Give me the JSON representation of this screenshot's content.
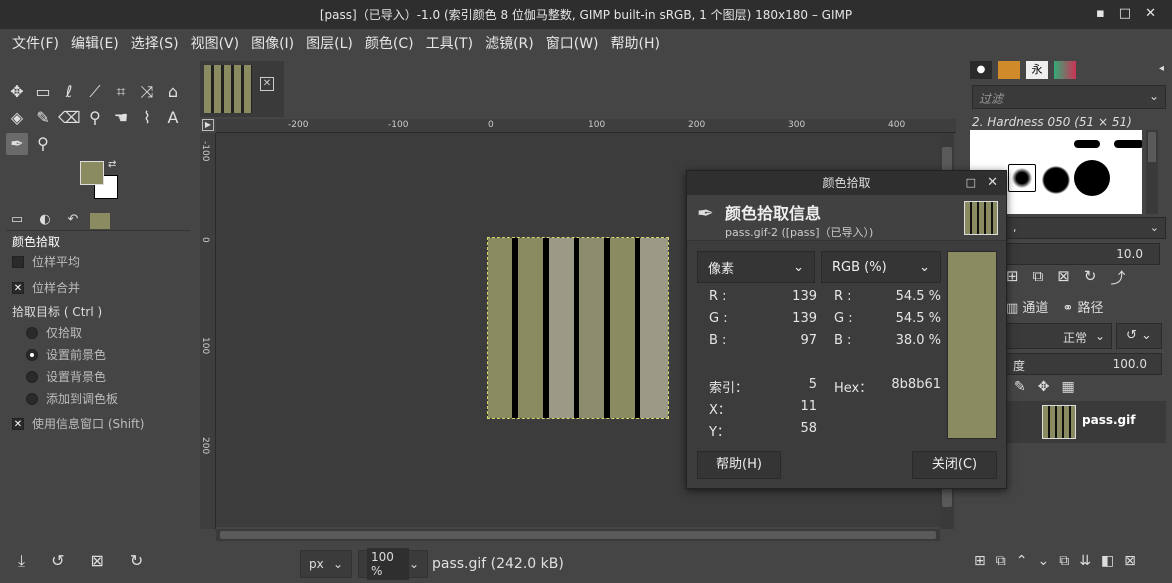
{
  "window": {
    "title": "[pass]（已导入）-1.0 (索引颜色 8 位伽马整数, GIMP built-in sRGB, 1 个图层) 180x180 – GIMP",
    "min": "▪",
    "max": "□",
    "close": "✕"
  },
  "menu": [
    "文件(F)",
    "编辑(E)",
    "选择(S)",
    "视图(V)",
    "图像(I)",
    "图层(L)",
    "颜色(C)",
    "工具(T)",
    "滤镜(R)",
    "窗口(W)",
    "帮助(H)"
  ],
  "tool_options": {
    "title": "颜色拾取",
    "sample_average": "位样平均",
    "sample_merged": "位样合并",
    "pick_target": "拾取目标 ( Ctrl )",
    "targets": [
      "仅拾取",
      "设置前景色",
      "设置背景色",
      "添加到调色板"
    ],
    "selected_target_index": 1,
    "use_info_window": "使用信息窗口 (Shift)"
  },
  "colors": {
    "fg": "#8b8b61",
    "bg": "#ffffff",
    "stripe_light": "#8b8b61",
    "stripe_mid": "#8c8c6e",
    "stripe_gray": "#9a9a86",
    "stripe_dark": "#000000"
  },
  "ruler": {
    "h": [
      "-200",
      "-100",
      "0",
      "100",
      "200",
      "300",
      "400"
    ],
    "v": [
      "-100",
      "0",
      "100",
      "200"
    ]
  },
  "status": {
    "unit": "px",
    "zoom": "100 %",
    "file": "pass.gif (242.0 kB)"
  },
  "color_picker_dialog": {
    "title": "颜色拾取",
    "header": "颜色拾取信息",
    "sub": "pass.gif-2 ([pass]（已导入）)",
    "left_mode": "像素",
    "right_mode": "RGB (%)",
    "pixel": {
      "R": "139",
      "G": "139",
      "B": "97"
    },
    "rgb_percent": {
      "R": "54.5 %",
      "G": "54.5 %",
      "B": "38.0 %"
    },
    "index_label": "索引：",
    "index": "5",
    "x_label": "X：",
    "x": "11",
    "y_label": "Y：",
    "y": "58",
    "hex_label": "Hex：",
    "hex": "8b8b61",
    "help": "帮助(H)",
    "close": "关闭(C)"
  },
  "right_dock": {
    "filter_placeholder": "过滤",
    "brush_name": "2. Hardness 050 (51 × 51)",
    "spacing": "10.0",
    "tabs": [
      "通道",
      "路径"
    ],
    "mode": "正常",
    "opacity_label": "度",
    "opacity": "100.0",
    "layer_name": "pass.gif"
  }
}
